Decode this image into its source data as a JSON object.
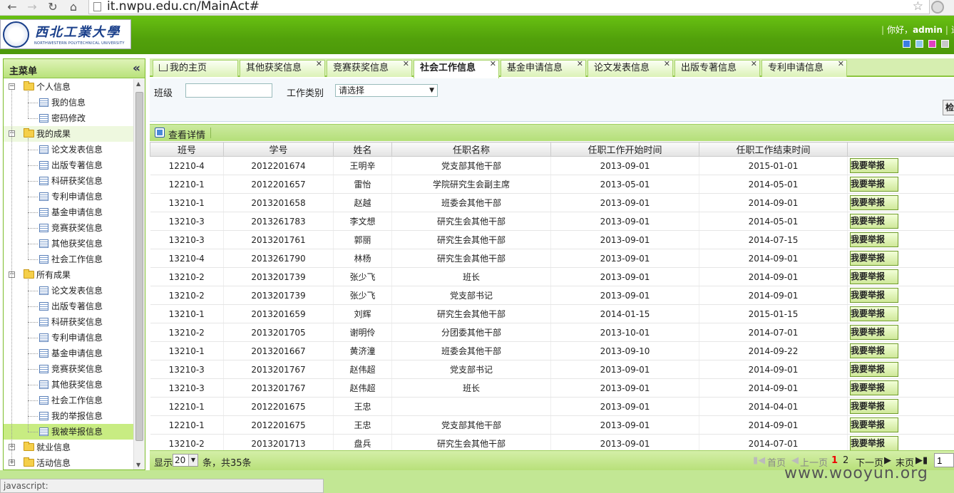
{
  "browser": {
    "url": "it.nwpu.edu.cn/MainAct#"
  },
  "header": {
    "logo_cn": "西北工業大學",
    "logo_en": "NORTHWESTERN POLYTECHNICAL UNIVERSITY",
    "greeting": "你好，",
    "user": "admin",
    "trailing": "退",
    "swatch_colors": [
      "#3b7de0",
      "#8ec8e8",
      "#e040c0",
      "#c8c8c8"
    ]
  },
  "sidebar": {
    "title": "主菜单",
    "groups": [
      {
        "label": "个人信息",
        "expanded": true,
        "items": [
          "我的信息",
          "密码修改"
        ]
      },
      {
        "label": "我的成果",
        "expanded": true,
        "items": [
          "论文发表信息",
          "出版专著信息",
          "科研获奖信息",
          "专利申请信息",
          "基金申请信息",
          "竞赛获奖信息",
          "其他获奖信息",
          "社会工作信息"
        ]
      },
      {
        "label": "所有成果",
        "expanded": true,
        "items": [
          "论文发表信息",
          "出版专著信息",
          "科研获奖信息",
          "专利申请信息",
          "基金申请信息",
          "竞赛获奖信息",
          "其他获奖信息",
          "社会工作信息",
          "我的举报信息",
          "我被举报信息"
        ]
      },
      {
        "label": "就业信息",
        "expanded": false,
        "items": []
      },
      {
        "label": "活动信息",
        "expanded": false,
        "items": []
      }
    ]
  },
  "tabs": [
    {
      "label": "我的主页",
      "closable": false,
      "active": false
    },
    {
      "label": "其他获奖信息",
      "closable": true,
      "active": false
    },
    {
      "label": "竞赛获奖信息",
      "closable": true,
      "active": false
    },
    {
      "label": "社会工作信息",
      "closable": true,
      "active": true
    },
    {
      "label": "基金申请信息",
      "closable": true,
      "active": false
    },
    {
      "label": "论文发表信息",
      "closable": true,
      "active": false
    },
    {
      "label": "出版专著信息",
      "closable": true,
      "active": false
    },
    {
      "label": "专利申请信息",
      "closable": true,
      "active": false
    }
  ],
  "search": {
    "class_label": "班级",
    "class_value": "",
    "worktype_label": "工作类别",
    "worktype_value": "请选择",
    "check_label": "检"
  },
  "toolbar": {
    "detail_label": "查看详情"
  },
  "table": {
    "columns": [
      "班号",
      "学号",
      "姓名",
      "任职名称",
      "任职工作开始时间",
      "任职工作结束时间",
      ""
    ],
    "report_label": "我要举报",
    "rows": [
      [
        "12210-4",
        "2012201674",
        "王明辛",
        "党支部其他干部",
        "2013-09-01",
        "2015-01-01"
      ],
      [
        "12210-1",
        "2012201657",
        "雷怡",
        "学院研究生会副主席",
        "2013-05-01",
        "2014-05-01"
      ],
      [
        "13210-1",
        "2013201658",
        "赵越",
        "班委会其他干部",
        "2013-09-01",
        "2014-09-01"
      ],
      [
        "13210-3",
        "2013261783",
        "李文想",
        "研究生会其他干部",
        "2013-09-01",
        "2014-05-01"
      ],
      [
        "13210-3",
        "2013201761",
        "郭丽",
        "研究生会其他干部",
        "2013-09-01",
        "2014-07-15"
      ],
      [
        "13210-4",
        "2013261790",
        "林杨",
        "研究生会其他干部",
        "2013-09-01",
        "2014-09-01"
      ],
      [
        "13210-2",
        "2013201739",
        "张少飞",
        "班长",
        "2013-09-01",
        "2014-09-01"
      ],
      [
        "13210-2",
        "2013201739",
        "张少飞",
        "党支部书记",
        "2013-09-01",
        "2014-09-01"
      ],
      [
        "13210-1",
        "2013201659",
        "刘辉",
        "研究生会其他干部",
        "2014-01-15",
        "2015-01-15"
      ],
      [
        "13210-2",
        "2013201705",
        "谢明伶",
        "分团委其他干部",
        "2013-10-01",
        "2014-07-01"
      ],
      [
        "13210-1",
        "2013201667",
        "黄济潼",
        "班委会其他干部",
        "2013-09-10",
        "2014-09-22"
      ],
      [
        "13210-3",
        "2013201767",
        "赵伟超",
        "党支部书记",
        "2013-09-01",
        "2014-09-01"
      ],
      [
        "13210-3",
        "2013201767",
        "赵伟超",
        "班长",
        "2013-09-01",
        "2014-09-01"
      ],
      [
        "12210-1",
        "2012201675",
        "王忠",
        "",
        "2013-09-01",
        "2014-04-01"
      ],
      [
        "12210-1",
        "2012201675",
        "王忠",
        "党支部其他干部",
        "2013-09-01",
        "2014-09-01"
      ],
      [
        "13210-2",
        "2013201713",
        "盘兵",
        "研究生会其他干部",
        "2013-09-01",
        "2014-07-01"
      ]
    ]
  },
  "pager": {
    "show": "显示",
    "page_size": "20",
    "total": "条，共35条",
    "first": "首页",
    "prev": "上一页",
    "pages": [
      "1",
      "2"
    ],
    "current": "1",
    "next": "下一页",
    "last": "末页",
    "goto_value": "1"
  },
  "status": {
    "text": "javascript:"
  },
  "watermark": "www.wooyun.org"
}
